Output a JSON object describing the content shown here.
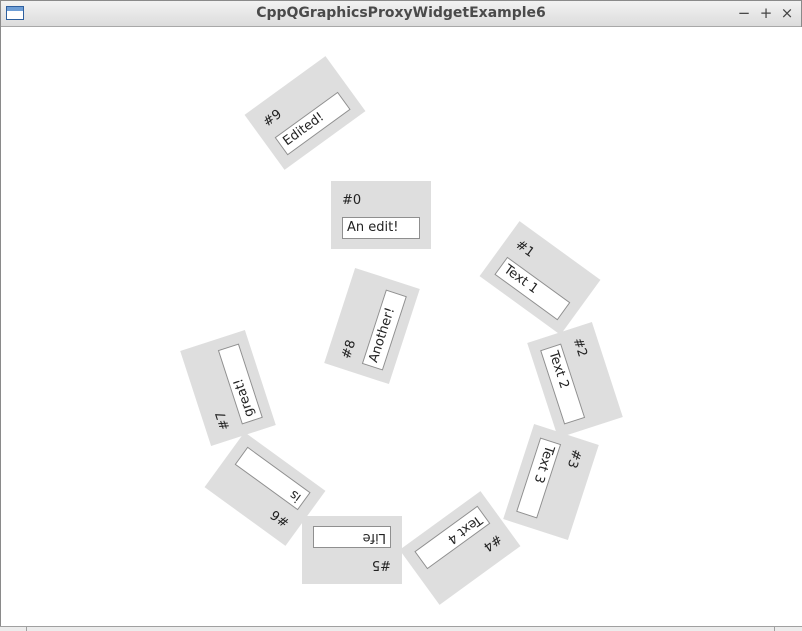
{
  "window": {
    "title": "CppQGraphicsProxyWidgetExample6",
    "minimize_glyph": "−",
    "maximize_glyph": "+",
    "close_glyph": "×",
    "app_icon": "window-app-icon"
  },
  "scene": {
    "widgets": [
      {
        "label": "#0",
        "text": "An edit!",
        "rotation_deg": 0
      },
      {
        "label": "#1",
        "text": "Text 1",
        "rotation_deg": 36
      },
      {
        "label": "#2",
        "text": "Text 2",
        "rotation_deg": 72
      },
      {
        "label": "#3",
        "text": "Text 3",
        "rotation_deg": 108
      },
      {
        "label": "#4",
        "text": "Text 4",
        "rotation_deg": 144
      },
      {
        "label": "#5",
        "text": "Life",
        "rotation_deg": 180
      },
      {
        "label": "#6",
        "text": "is",
        "rotation_deg": 216
      },
      {
        "label": "#7",
        "text": "great!",
        "rotation_deg": 252
      },
      {
        "label": "#8",
        "text": "Another!",
        "rotation_deg": 288
      },
      {
        "label": "#9",
        "text": "Edited!",
        "rotation_deg": 324
      }
    ]
  }
}
